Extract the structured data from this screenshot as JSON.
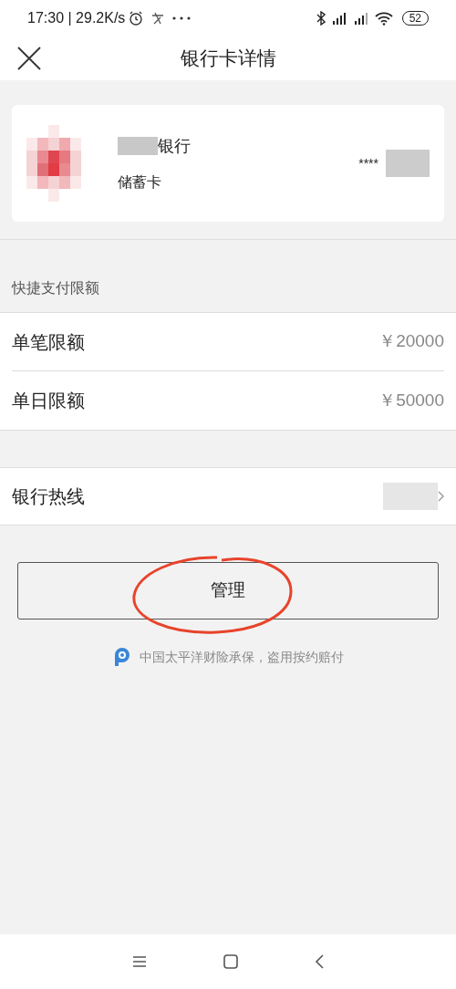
{
  "status_bar": {
    "text": "17:30 | 29.2K/s",
    "battery": "52"
  },
  "header": {
    "title": "银行卡详情"
  },
  "card": {
    "bank_name": "银行",
    "card_type": "储蓄卡",
    "number_mask": "****"
  },
  "limits": {
    "title": "快捷支付限额",
    "rows": [
      {
        "label": "单笔限额",
        "value": "￥20000"
      },
      {
        "label": "单日限额",
        "value": "￥50000"
      }
    ]
  },
  "hotline": {
    "label": "银行热线"
  },
  "manage_button": {
    "label": "管理"
  },
  "insurance_note": "中国太平洋财险承保，盗用按约赔付"
}
